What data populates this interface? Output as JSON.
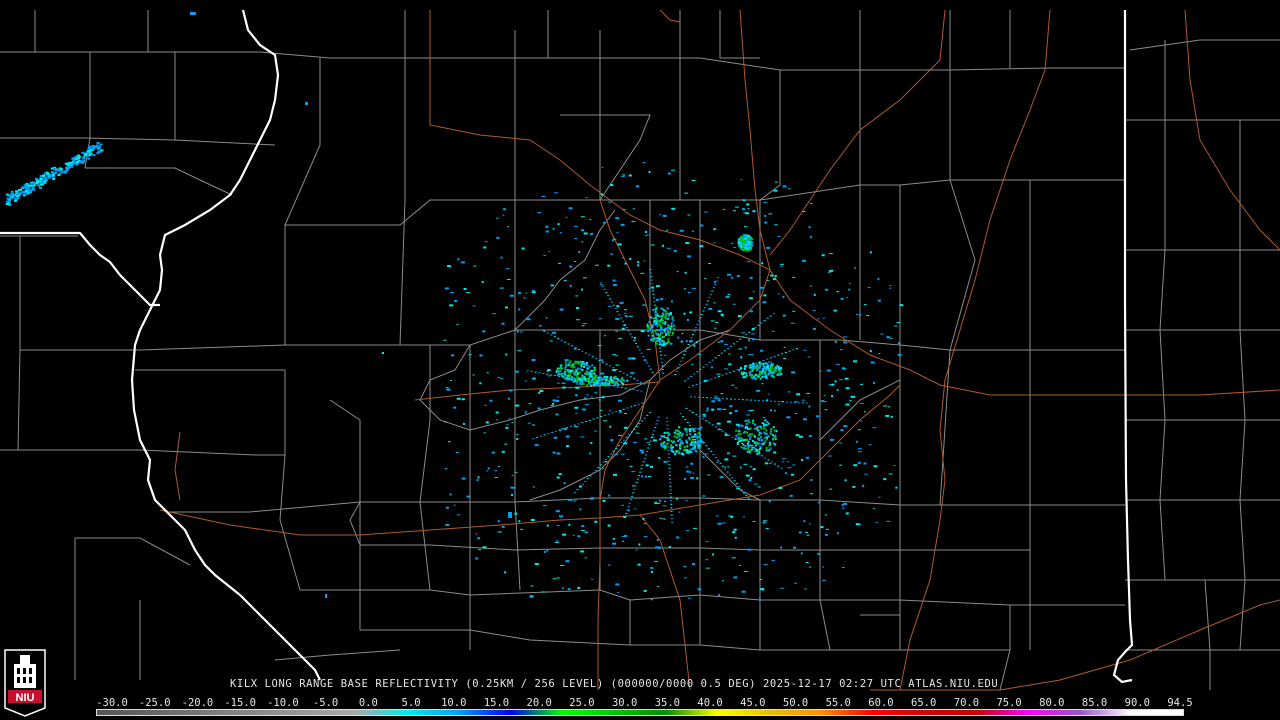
{
  "product": {
    "title": "KILX LONG RANGE BASE REFLECTIVITY (0.25KM / 256 LEVEL) (000000/0000 0.5 DEG) 2025-12-17 02:27 UTC  ATLAS.NIU.EDU"
  },
  "logo": {
    "text": "NIU",
    "colors": {
      "red": "#c8102e",
      "white": "#ffffff",
      "bg": "#000000"
    }
  },
  "scale": {
    "ticks": [
      "-30.0",
      "-25.0",
      "-20.0",
      "-15.0",
      "-10.0",
      "-5.0",
      "0.0",
      "5.0",
      "10.0",
      "15.0",
      "20.0",
      "25.0",
      "30.0",
      "35.0",
      "40.0",
      "45.0",
      "50.0",
      "55.0",
      "60.0",
      "65.0",
      "70.0",
      "75.0",
      "80.0",
      "85.0",
      "90.0",
      "94.5"
    ],
    "gradient_colors": [
      "#555555",
      "#666666",
      "#777777",
      "#888888",
      "#999999",
      "#aaaaaa",
      "#00ecec",
      "#01a0f6",
      "#0000f6",
      "#00ff00",
      "#00c800",
      "#009000",
      "#ffff00",
      "#e7c000",
      "#ff9000",
      "#ff0000",
      "#d60000",
      "#c00000",
      "#ff00ff",
      "#9955c9",
      "#ffffff",
      "#ffffff"
    ]
  },
  "colors": {
    "background": "#000000",
    "state_border": "#ffffff",
    "county_border": "#8c8c8c",
    "highway": "#b05a2a",
    "echo_light": "#00a0f6",
    "echo_cyan": "#00ecec",
    "echo_green": "#00c800"
  }
}
